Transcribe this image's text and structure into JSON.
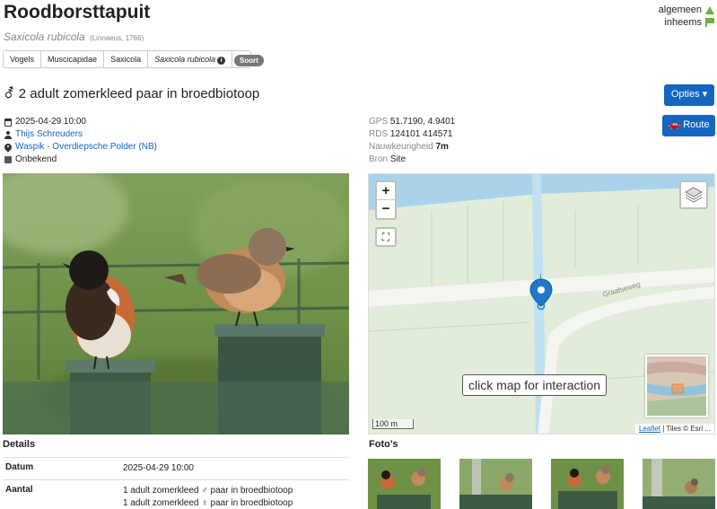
{
  "species": {
    "name": "Roodborsttapuit",
    "scientific": "Saxicola rubicola",
    "author": "(Linnaeus, 1766)"
  },
  "status": [
    {
      "label": "algemeen",
      "icon": "triangle-icon"
    },
    {
      "label": "inheems",
      "icon": "flag-icon"
    }
  ],
  "breadcrumb": {
    "items": [
      "Vogels",
      "Muscicapidae",
      "Saxicola"
    ],
    "current": "Saxicola rubicola",
    "dropdown_icon": "caret-down-icon",
    "rank_badge": "Soort"
  },
  "observation": {
    "sex_icon": "⚦",
    "title": "2 adult zomerkleed paar in broedbiotoop"
  },
  "buttons": {
    "options": "Opties ▾",
    "route": "Route"
  },
  "meta": {
    "datetime": "2025-04-29 10:00",
    "observer": "Thijs Schreuders",
    "location": "Waspik - Overdiepsche Polder (NB)",
    "validation": "Onbekend"
  },
  "coords": {
    "gps_label": "GPS",
    "gps_value": "51.7190, 4.9401",
    "rds_label": "RDS",
    "rds_value": "124101 414571",
    "accuracy_label": "Nauwkeurigheid",
    "accuracy_value": "7m",
    "source_label": "Bron",
    "source_value": "Site"
  },
  "map": {
    "zoom_in": "+",
    "zoom_out": "−",
    "fullscreen": "⛶",
    "click_message": "click map for interaction",
    "scale": "100 m",
    "road_label": "Graafseweg",
    "attribution_link": "Leaflet",
    "attribution_text": "| Tiles © Esri ..."
  },
  "details": {
    "heading": "Details",
    "rows": [
      {
        "key": "Datum",
        "values": [
          "2025-04-29 10:00"
        ]
      },
      {
        "key": "Aantal",
        "values": [
          "1 adult zomerkleed ♂ paar in broedbiotoop",
          "1 adult zomerkleed ♀ paar in broedbiotoop"
        ]
      }
    ]
  },
  "photos": {
    "heading": "Foto's"
  },
  "colors": {
    "accent": "#1565c0",
    "status_green": "#6cb33f"
  }
}
